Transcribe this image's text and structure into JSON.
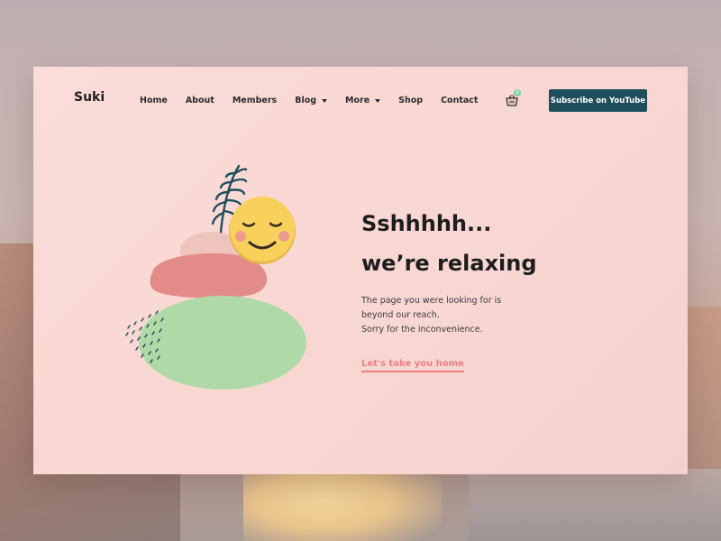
{
  "brand": {
    "logo": "Suki"
  },
  "nav": {
    "home": "Home",
    "about": "About",
    "members": "Members",
    "blog": "Blog",
    "more": "More",
    "shop": "Shop",
    "contact": "Contact"
  },
  "cart": {
    "count": "0"
  },
  "header": {
    "subscribe_label": "Subscribe on YouTube"
  },
  "message": {
    "headline_1": "Sshhhhh...",
    "headline_2": "we’re relaxing",
    "body_1": "The page you were looking for is",
    "body_2": "beyond our reach.",
    "body_3": "Sorry for the inconvenience.",
    "link": "Let's take you home"
  },
  "colors": {
    "card_bg": "#f8d6d2",
    "accent": "#ec7f86",
    "button": "#1e4e5a",
    "green_blob": "#afd9a7",
    "red_blob": "#e38b88",
    "pink_blob": "#efc4bd",
    "emoji": "#f8d15c"
  },
  "icons": {
    "cart": "shopping-basket-icon",
    "caret": "chevron-down-icon",
    "emoji": "relieved-face-icon",
    "plant": "leaf-icon"
  }
}
